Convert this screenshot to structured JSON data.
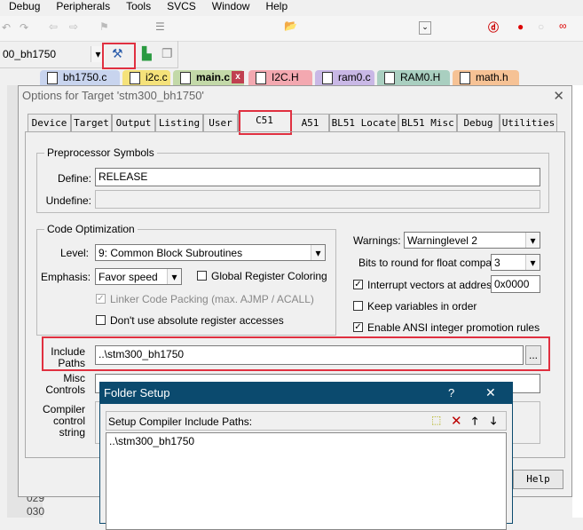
{
  "menu": [
    "Debug",
    "Peripherals",
    "Tools",
    "SVCS",
    "Window",
    "Help"
  ],
  "target_select": "00_bh1750",
  "file_tabs": [
    {
      "label": "bh1750.c",
      "color": "#c8d4ee"
    },
    {
      "label": "i2c.c",
      "color": "#f5e27a"
    },
    {
      "label": "main.c",
      "color": "#c3d9a8"
    },
    {
      "label": "I2C.H",
      "color": "#f3a8b0"
    },
    {
      "label": "ram0.c",
      "color": "#c9b8e6"
    },
    {
      "label": "RAM0.H",
      "color": "#a9cfc0"
    },
    {
      "label": "math.h",
      "color": "#f6c295"
    }
  ],
  "options_dialog": {
    "title": "Options for Target 'stm300_bh1750'",
    "close": "✕",
    "tabs": [
      "Device",
      "Target",
      "Output",
      "Listing",
      "User",
      "C51",
      "A51",
      "BL51 Locate",
      "BL51 Misc",
      "Debug",
      "Utilities"
    ],
    "active_tab": "C51",
    "preprocessor": {
      "title": "Preprocessor Symbols",
      "define_label": "Define:",
      "define_value": "RELEASE",
      "undefine_label": "Undefine:",
      "undefine_value": ""
    },
    "code_opt": {
      "title": "Code Optimization",
      "level_label": "Level:",
      "level_value": "9: Common Block Subroutines",
      "emphasis_label": "Emphasis:",
      "emphasis_value": "Favor speed",
      "global_reg": "Global Register Coloring",
      "linker_packing": "Linker Code Packing (max. AJMP / ACALL)",
      "no_abs_reg": "Don't use absolute register accesses"
    },
    "warnings_label": "Warnings:",
    "warnings_value": "Warninglevel 2",
    "bits_label": "Bits to round for float compare:",
    "bits_value": "3",
    "interrupt_label": "Interrupt vectors at address:",
    "interrupt_value": "0x0000",
    "keep_vars": "Keep variables in order",
    "ansi_int": "Enable ANSI integer promotion rules",
    "include_label": [
      "Include",
      "Paths"
    ],
    "include_value": "..\\stm300_bh1750",
    "browse": "...",
    "misc_label": [
      "Misc",
      "Controls"
    ],
    "misc_value": "",
    "compiler_label": [
      "Compiler",
      "control",
      "string"
    ],
    "help": "Help"
  },
  "folder_setup": {
    "title": "Folder Setup",
    "help": "?",
    "close": "✕",
    "header": "Setup Compiler Include Paths:",
    "items": [
      "..\\stm300_bh1750"
    ]
  },
  "line_numbers": [
    "029",
    "030"
  ]
}
